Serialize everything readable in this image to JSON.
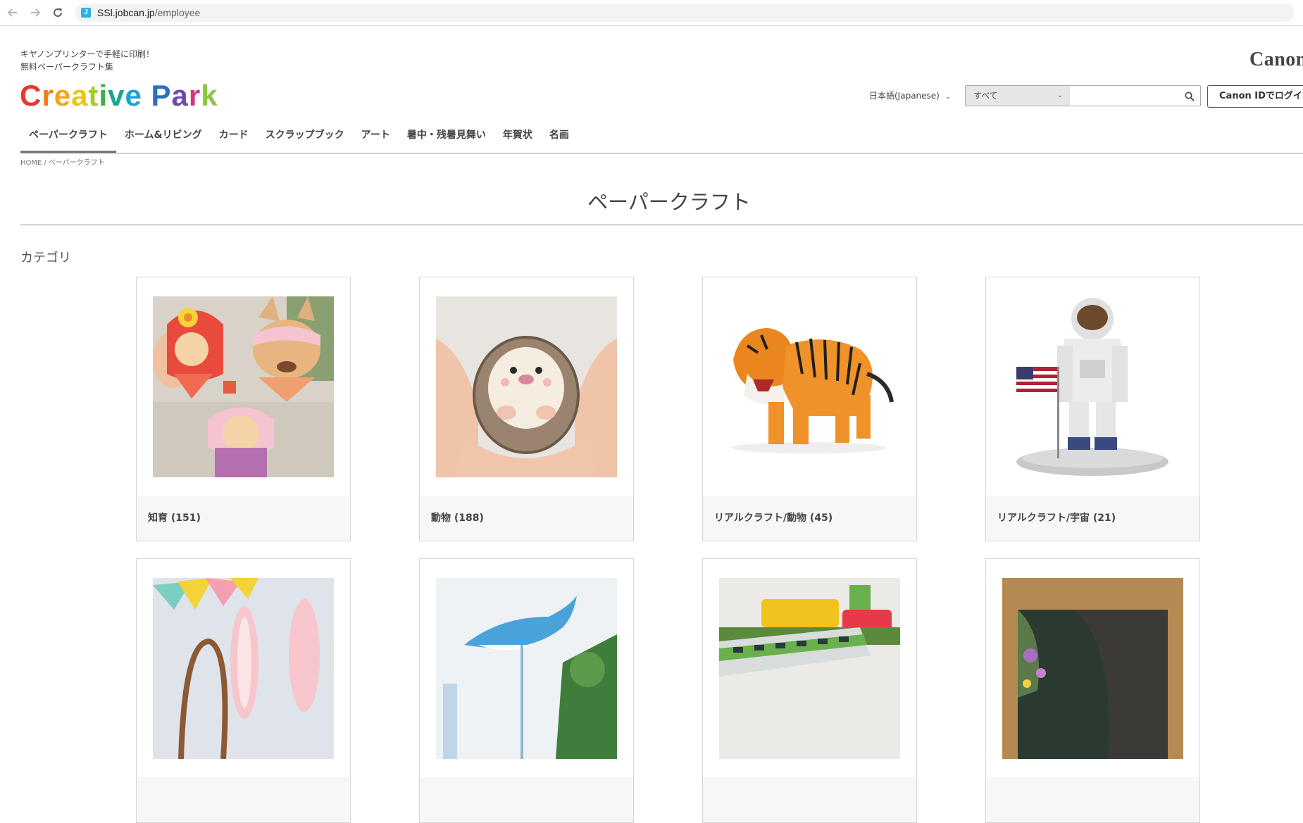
{
  "browser": {
    "favicon_letter": "J",
    "url_host": "SSl.jobcan.jp",
    "url_path": "/employee"
  },
  "header": {
    "tagline_line1": "キヤノンプリンターで手軽に印刷！",
    "tagline_line2": "無料ペーパークラフト集",
    "logo_letters": [
      {
        "ch": "C",
        "color": "#e8382b"
      },
      {
        "ch": "r",
        "color": "#ef7d1a"
      },
      {
        "ch": "e",
        "color": "#f3a41b"
      },
      {
        "ch": "a",
        "color": "#e9c41c"
      },
      {
        "ch": "t",
        "color": "#a8c92e"
      },
      {
        "ch": "i",
        "color": "#3fae49"
      },
      {
        "ch": "v",
        "color": "#1aa68d"
      },
      {
        "ch": "e",
        "color": "#1aa0d8"
      },
      {
        "ch": " ",
        "color": "#ffffff"
      },
      {
        "ch": "P",
        "color": "#2a6fc1"
      },
      {
        "ch": "a",
        "color": "#6a4bb0"
      },
      {
        "ch": "r",
        "color": "#d7367f"
      },
      {
        "ch": "k",
        "color": "#8cc63f"
      }
    ],
    "canon_logo": "Canon",
    "language": "日本語(Japanese)",
    "search_category": "すべて",
    "search_placeholder": "",
    "login_label": "Canon IDでログイン"
  },
  "nav": {
    "items": [
      {
        "label": "ペーパークラフト",
        "active": true
      },
      {
        "label": "ホーム&リビング",
        "active": false
      },
      {
        "label": "カード",
        "active": false
      },
      {
        "label": "スクラップブック",
        "active": false
      },
      {
        "label": "アート",
        "active": false
      },
      {
        "label": "暑中・残暑見舞い",
        "active": false
      },
      {
        "label": "年賀状",
        "active": false
      },
      {
        "label": "名画",
        "active": false
      }
    ]
  },
  "breadcrumb": {
    "home": "HOME",
    "separator": "/",
    "current": "ペーパークラフト"
  },
  "page": {
    "title": "ペーパークラフト",
    "section_heading": "カテゴリ"
  },
  "categories": [
    {
      "label": "知育 (151)",
      "image": "finger-puppets-image"
    },
    {
      "label": "動物 (188)",
      "image": "hedgehog-image"
    },
    {
      "label": "リアルクラフト/動物 (45)",
      "image": "tiger-image"
    },
    {
      "label": "リアルクラフト/宇宙 (21)",
      "image": "astronaut-image"
    },
    {
      "label": "",
      "image": "bunny-ears-image"
    },
    {
      "label": "",
      "image": "dolphin-image"
    },
    {
      "label": "",
      "image": "toy-train-image"
    },
    {
      "label": "",
      "image": "painting-frame-image"
    }
  ]
}
